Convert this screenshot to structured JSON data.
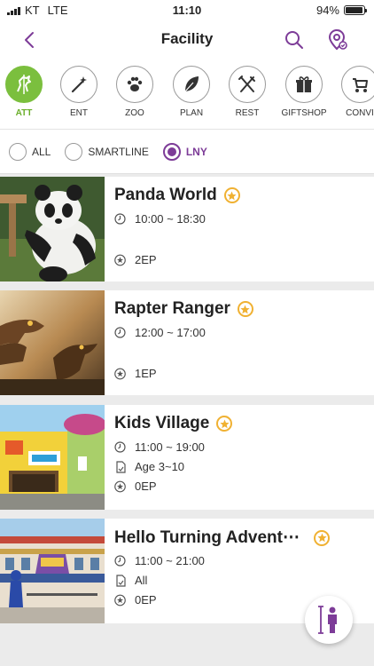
{
  "status": {
    "carrier": "KT",
    "network": "LTE",
    "time": "11:10",
    "battery": "94%",
    "battery_level": 0.94
  },
  "header": {
    "title": "Facility",
    "back_icon": "chevron-left-icon",
    "search_icon": "search-icon",
    "location_icon": "map-pin-icon"
  },
  "categories": [
    {
      "label": "ATT",
      "icon": "carousel-horse-icon",
      "active": true
    },
    {
      "label": "ENT",
      "icon": "magic-wand-icon",
      "active": false
    },
    {
      "label": "ZOO",
      "icon": "paw-icon",
      "active": false
    },
    {
      "label": "PLAN",
      "icon": "leaf-icon",
      "active": false
    },
    {
      "label": "REST",
      "icon": "fork-knife-icon",
      "active": false
    },
    {
      "label": "GIFTSHOP",
      "icon": "gift-icon",
      "active": false
    },
    {
      "label": "CONVI",
      "icon": "stroller-icon",
      "active": false
    }
  ],
  "filters": [
    {
      "label": "ALL",
      "selected": false
    },
    {
      "label": "SMARTLINE",
      "selected": false
    },
    {
      "label": "LNY",
      "selected": true
    }
  ],
  "facilities": [
    {
      "name": "Panda World",
      "hours": "10:00 ~ 18:30",
      "age": "",
      "ep": "2EP"
    },
    {
      "name": "Rapter Ranger",
      "hours": "12:00 ~ 17:00",
      "age": "",
      "ep": "1EP"
    },
    {
      "name": "Kids Village",
      "hours": "11:00 ~ 19:00",
      "age": "Age 3~10",
      "ep": "0EP"
    },
    {
      "name": "Hello Turning Advent⋯",
      "hours": "11:00 ~ 21:00",
      "age": "All",
      "ep": "0EP"
    }
  ],
  "fab": {
    "icon": "height-measure-icon"
  },
  "colors": {
    "accent": "#7d3c98",
    "active_category": "#7bbf3e",
    "favorite": "#f0b132"
  }
}
